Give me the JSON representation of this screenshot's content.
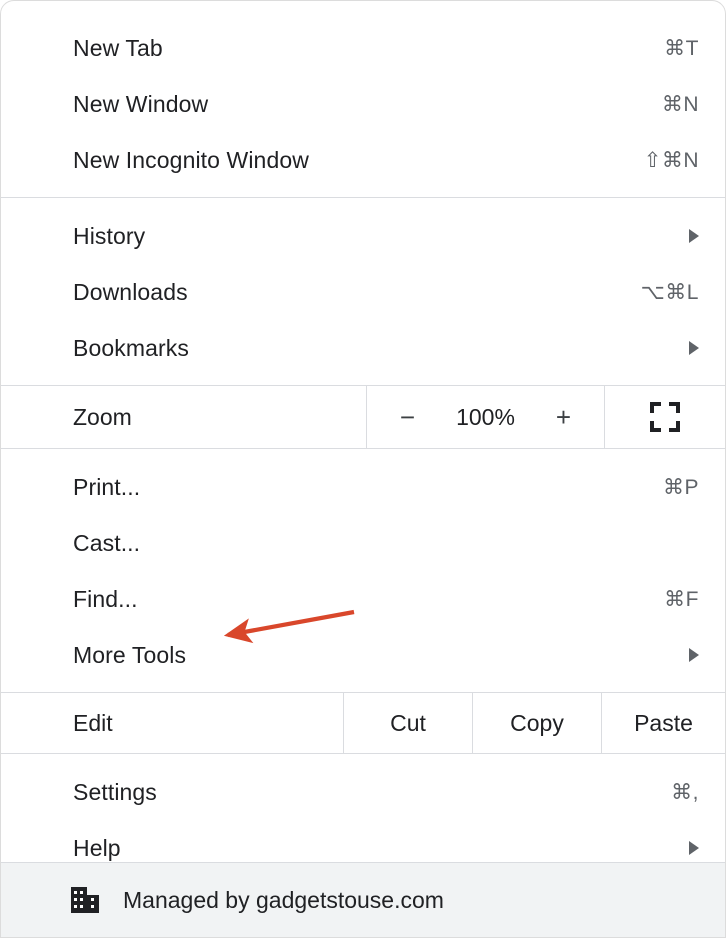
{
  "menu": {
    "sections": [
      {
        "id": "new",
        "items": [
          {
            "label": "New Tab",
            "accel": "⌘T",
            "submenu": false
          },
          {
            "label": "New Window",
            "accel": "⌘N",
            "submenu": false
          },
          {
            "label": "New Incognito Window",
            "accel": "⇧⌘N",
            "submenu": false
          }
        ]
      },
      {
        "id": "browse",
        "items": [
          {
            "label": "History",
            "accel": "",
            "submenu": true
          },
          {
            "label": "Downloads",
            "accel": "⌥⌘L",
            "submenu": false
          },
          {
            "label": "Bookmarks",
            "accel": "",
            "submenu": true
          }
        ]
      },
      {
        "id": "tools",
        "items": [
          {
            "label": "Print...",
            "accel": "⌘P",
            "submenu": false
          },
          {
            "label": "Cast...",
            "accel": "",
            "submenu": false
          },
          {
            "label": "Find...",
            "accel": "⌘F",
            "submenu": false
          },
          {
            "label": "More Tools",
            "accel": "",
            "submenu": true
          }
        ]
      },
      {
        "id": "prefs",
        "items": [
          {
            "label": "Settings",
            "accel": "⌘,",
            "submenu": false
          },
          {
            "label": "Help",
            "accel": "",
            "submenu": true
          }
        ]
      }
    ],
    "zoom_row": {
      "label": "Zoom",
      "decrease_label": "−",
      "level": "100%",
      "increase_label": "+",
      "fullscreen_icon": "fullscreen-icon"
    },
    "edit_row": {
      "label": "Edit",
      "cut_label": "Cut",
      "copy_label": "Copy",
      "paste_label": "Paste"
    },
    "footer": {
      "icon": "business-building-icon",
      "text": "Managed by gadgetstouse.com"
    },
    "annotation": {
      "type": "arrow",
      "color": "#d9472b",
      "points_at": "More Tools"
    }
  }
}
